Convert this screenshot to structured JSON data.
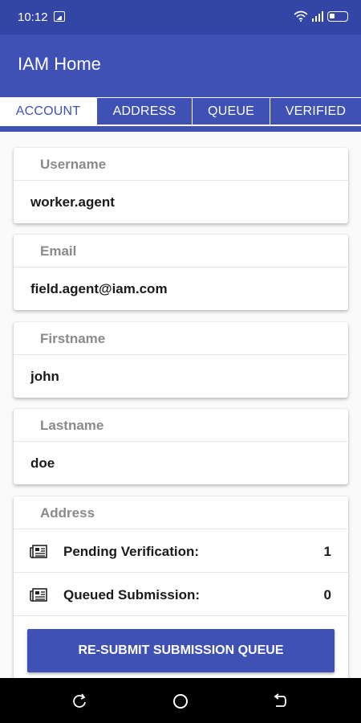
{
  "status_bar": {
    "time": "10:12"
  },
  "app_bar": {
    "title": "IAM Home"
  },
  "tabs": [
    {
      "label": "ACCOUNT",
      "active": true
    },
    {
      "label": "ADDRESS",
      "active": false
    },
    {
      "label": "QUEUE",
      "active": false
    },
    {
      "label": "VERIFIED",
      "active": false
    }
  ],
  "fields": [
    {
      "label": "Username",
      "value": "worker.agent"
    },
    {
      "label": "Email",
      "value": "field.agent@iam.com"
    },
    {
      "label": "Firstname",
      "value": "john"
    },
    {
      "label": "Lastname",
      "value": "doe"
    }
  ],
  "address_card": {
    "label": "Address",
    "rows": [
      {
        "icon": "newspaper-icon",
        "label": "Pending Verification:",
        "count": "1"
      },
      {
        "icon": "newspaper-icon",
        "label": "Queued Submission:",
        "count": "0"
      }
    ],
    "resubmit_label": "RE-SUBMIT SUBMISSION QUEUE"
  },
  "colors": {
    "primary": "#3f51b5",
    "status_bar": "#3346a6",
    "label_gray": "#8a8a8a"
  }
}
